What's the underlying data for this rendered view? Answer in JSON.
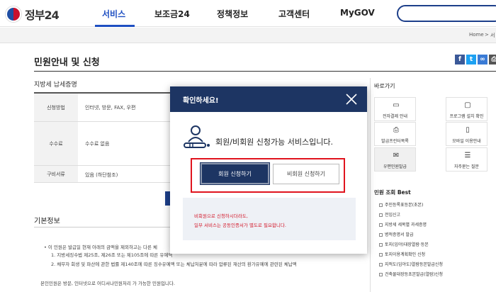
{
  "header": {
    "logo_text": "정부24",
    "nav": [
      "서비스",
      "보조금24",
      "정책정보",
      "고객센터",
      "MyGOV"
    ],
    "active_nav": "서비스"
  },
  "breadcrumb": {
    "home": "Home",
    "sep": ">",
    "next": "서"
  },
  "page": {
    "title": "민원안내 및 신청",
    "section_title": "지방세 납세증명",
    "table": [
      {
        "label": "신청방법",
        "value": "인터넷, 방문, FAX, 우편"
      },
      {
        "label": "수수료",
        "value": "수수료 없음"
      },
      {
        "label": "구비서류",
        "value": "있음 (하단참조)"
      }
    ],
    "basic_info_title": "기본정보",
    "basic_lines": [
      "• 이 민원은 발급일 현재 아래의 금액을 제외하고는 다른 체",
      "1. 지방세징수법 제25조, 제26조 또는 제105조에 따른 유예액",
      "2. 채무자 회생 및 파산에 관한 법률 제140조에 따른 징수유예액 또는 체납처분에 따라 압류된 재산의 환가유예에 관련된 체납액",
      "본인민원은 방문, 인터넷으로 어디서나민원처리 가 가능한 민원입니다."
    ]
  },
  "sidebar": {
    "quick_title": "바로가기",
    "quick_items": [
      {
        "label": "전자결제 안내",
        "icon": "card-icon"
      },
      {
        "label": "프로그램 설치 확인",
        "icon": "monitor-icon"
      },
      {
        "label": "발급프린터목록",
        "icon": "printer-icon"
      },
      {
        "label": "모바일 이용안내",
        "icon": "mobile-icon"
      },
      {
        "label": "우편민원발급",
        "icon": "mail-icon"
      },
      {
        "label": "자주묻는 질문",
        "icon": "chat-icon"
      }
    ],
    "best_title": "민원 조회 Best",
    "best_items": [
      "주민등록표등본(초본)",
      "전입신고",
      "지방세 세목별 과세증명",
      "병적증명서 발급",
      "토지(임야)대장열람·등본",
      "토지이용계획확인 신청",
      "지적도(임야도)열람등본발급신청",
      "건축물대장등초본발급(열람)신청"
    ]
  },
  "modal": {
    "title": "확인하세요!",
    "message": "회원/비회원 신청가능 서비스입니다.",
    "member_button": "회원 신청하기",
    "nonmember_button": "비회원 신청하기",
    "notice_lines": [
      "비회원으로 신청하시더라도,",
      "일부 서비스는 공동인증서가 별도로 필요합니다."
    ],
    "highlight_color": "#e0141e",
    "accent_color": "#1d3563"
  }
}
